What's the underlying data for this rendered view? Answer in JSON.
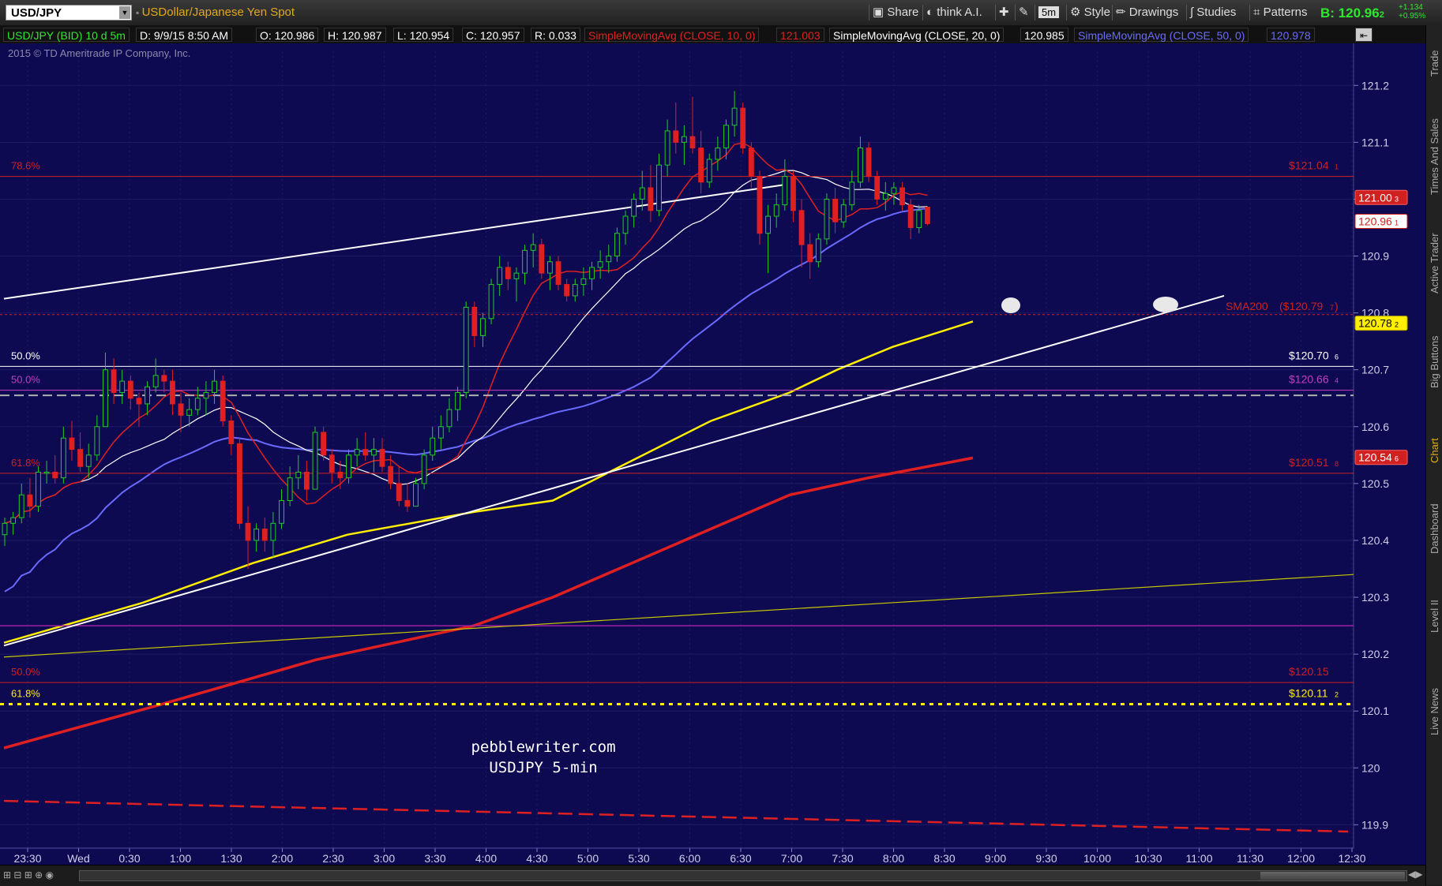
{
  "header": {
    "symbol": "USD/JPY",
    "description": "USDollar/Japanese Yen Spot",
    "toolbar": {
      "share": "Share",
      "think": "think A.I.",
      "interval": "5m",
      "style": "Style",
      "drawings": "Drawings",
      "studies": "Studies",
      "patterns": "Patterns"
    },
    "bid_label": "B:",
    "bid_value": "120.96",
    "bid_small": "2",
    "change1": "+1.134",
    "change2": "+0.95%"
  },
  "infobar": {
    "symbol_info": "USD/JPY (BID) 10 d 5m",
    "date": "D: 9/9/15 8:50 AM",
    "open": "O: 120.986",
    "high": "H: 120.987",
    "low": "L: 120.954",
    "close": "C: 120.957",
    "range": "R: 0.033",
    "sma10": "SimpleMovingAvg (CLOSE, 10, 0)",
    "sma10_value": "121.003",
    "sma20": "SimpleMovingAvg (CLOSE, 20, 0)",
    "sma20_value": "120.985",
    "sma50": "SimpleMovingAvg (CLOSE, 50, 0)",
    "sma50_value": "120.978"
  },
  "copyright": "2015 © TD Ameritrade IP Company, Inc.",
  "watermark": [
    "pebblewriter.com",
    "USDJPY 5-min"
  ],
  "right_tabs": [
    "Trade",
    "Times And Sales",
    "Active Trader",
    "Big Buttons",
    "Chart",
    "Dashboard",
    "Level II",
    "Live News"
  ],
  "chart_data": {
    "type": "candlestick",
    "title": "USD/JPY (BID) 10 d 5m",
    "x_tick_labels": [
      "23:30",
      "Wed",
      "0:30",
      "1:00",
      "1:30",
      "2:00",
      "2:30",
      "3:00",
      "3:30",
      "4:00",
      "4:30",
      "5:00",
      "5:30",
      "6:00",
      "6:30",
      "7:00",
      "7:30",
      "8:00",
      "8:30",
      "9:00",
      "9:30",
      "10:00",
      "10:30",
      "11:00",
      "11:30",
      "12:00",
      "12:30"
    ],
    "y_tick_labels": [
      "121.2",
      "121.1",
      "121",
      "120.9",
      "120.8",
      "120.7",
      "120.6",
      "120.5",
      "120.4",
      "120.3",
      "120.2",
      "120.1",
      "120",
      "119.9"
    ],
    "ylim": [
      119.87,
      121.26
    ],
    "candles": [
      [
        120.41,
        120.44,
        120.39,
        120.43
      ],
      [
        120.43,
        120.45,
        120.41,
        120.44
      ],
      [
        120.44,
        120.5,
        120.43,
        120.48
      ],
      [
        120.48,
        120.51,
        120.44,
        120.46
      ],
      [
        120.46,
        120.53,
        120.45,
        120.52
      ],
      [
        120.52,
        120.54,
        120.5,
        120.52
      ],
      [
        120.52,
        120.55,
        120.5,
        120.51
      ],
      [
        120.51,
        120.6,
        120.5,
        120.58
      ],
      [
        120.58,
        120.61,
        120.54,
        120.56
      ],
      [
        120.56,
        120.59,
        120.52,
        120.53
      ],
      [
        120.53,
        120.57,
        120.51,
        120.55
      ],
      [
        120.55,
        120.62,
        120.54,
        120.6
      ],
      [
        120.6,
        120.73,
        120.6,
        120.7
      ],
      [
        120.7,
        120.72,
        120.64,
        120.66
      ],
      [
        120.66,
        120.7,
        120.64,
        120.68
      ],
      [
        120.68,
        120.69,
        120.63,
        120.65
      ],
      [
        120.65,
        120.66,
        120.6,
        120.64
      ],
      [
        120.64,
        120.68,
        120.62,
        120.67
      ],
      [
        120.67,
        120.72,
        120.66,
        120.69
      ],
      [
        120.69,
        120.7,
        120.66,
        120.68
      ],
      [
        120.68,
        120.7,
        120.62,
        120.64
      ],
      [
        120.64,
        120.66,
        120.59,
        120.62
      ],
      [
        120.62,
        120.65,
        120.6,
        120.63
      ],
      [
        120.63,
        120.67,
        120.62,
        120.65
      ],
      [
        120.65,
        120.68,
        120.62,
        120.66
      ],
      [
        120.66,
        120.7,
        120.64,
        120.68
      ],
      [
        120.68,
        120.69,
        120.6,
        120.61
      ],
      [
        120.61,
        120.62,
        120.55,
        120.57
      ],
      [
        120.57,
        120.58,
        120.42,
        120.43
      ],
      [
        120.43,
        120.46,
        120.35,
        120.4
      ],
      [
        120.4,
        120.43,
        120.38,
        120.42
      ],
      [
        120.42,
        120.44,
        120.38,
        120.4
      ],
      [
        120.4,
        120.45,
        120.37,
        120.43
      ],
      [
        120.43,
        120.49,
        120.42,
        120.47
      ],
      [
        120.47,
        120.53,
        120.46,
        120.51
      ],
      [
        120.51,
        120.55,
        120.49,
        120.52
      ],
      [
        120.52,
        120.54,
        120.47,
        120.49
      ],
      [
        120.49,
        120.6,
        120.49,
        120.59
      ],
      [
        120.59,
        120.6,
        120.54,
        120.55
      ],
      [
        120.55,
        120.56,
        120.5,
        120.52
      ],
      [
        120.52,
        120.54,
        120.49,
        120.51
      ],
      [
        120.51,
        120.56,
        120.5,
        120.55
      ],
      [
        120.55,
        120.58,
        120.53,
        120.56
      ],
      [
        120.56,
        120.59,
        120.54,
        120.55
      ],
      [
        120.55,
        120.58,
        120.52,
        120.56
      ],
      [
        120.56,
        120.58,
        120.52,
        120.53
      ],
      [
        120.53,
        120.55,
        120.49,
        120.5
      ],
      [
        120.5,
        120.53,
        120.46,
        120.47
      ],
      [
        120.47,
        120.5,
        120.45,
        120.46
      ],
      [
        120.46,
        120.51,
        120.46,
        120.5
      ],
      [
        120.5,
        120.56,
        120.49,
        120.55
      ],
      [
        120.55,
        120.6,
        120.54,
        120.58
      ],
      [
        120.58,
        120.62,
        120.56,
        120.6
      ],
      [
        120.6,
        120.65,
        120.59,
        120.63
      ],
      [
        120.63,
        120.67,
        120.61,
        120.66
      ],
      [
        120.66,
        120.82,
        120.65,
        120.81
      ],
      [
        120.81,
        120.82,
        120.74,
        120.76
      ],
      [
        120.76,
        120.8,
        120.74,
        120.79
      ],
      [
        120.79,
        120.86,
        120.78,
        120.85
      ],
      [
        120.85,
        120.9,
        120.83,
        120.88
      ],
      [
        120.88,
        120.89,
        120.84,
        120.86
      ],
      [
        120.86,
        120.88,
        120.82,
        120.87
      ],
      [
        120.87,
        120.92,
        120.85,
        120.91
      ],
      [
        120.91,
        120.94,
        120.88,
        120.92
      ],
      [
        120.92,
        120.93,
        120.86,
        120.87
      ],
      [
        120.87,
        120.9,
        120.84,
        120.89
      ],
      [
        120.89,
        120.9,
        120.84,
        120.85
      ],
      [
        120.85,
        120.86,
        120.82,
        120.83
      ],
      [
        120.83,
        120.86,
        120.82,
        120.85
      ],
      [
        120.85,
        120.88,
        120.83,
        120.86
      ],
      [
        120.86,
        120.89,
        120.84,
        120.88
      ],
      [
        120.88,
        120.91,
        120.86,
        120.89
      ],
      [
        120.89,
        120.92,
        120.87,
        120.9
      ],
      [
        120.9,
        120.95,
        120.89,
        120.94
      ],
      [
        120.94,
        120.98,
        120.92,
        120.97
      ],
      [
        120.97,
        121.01,
        120.95,
        121.0
      ],
      [
        121.0,
        121.05,
        120.98,
        121.02
      ],
      [
        121.02,
        121.06,
        120.96,
        120.98
      ],
      [
        120.98,
        121.08,
        120.97,
        121.06
      ],
      [
        121.06,
        121.14,
        121.04,
        121.12
      ],
      [
        121.12,
        121.17,
        121.08,
        121.1
      ],
      [
        121.1,
        121.13,
        121.06,
        121.11
      ],
      [
        121.11,
        121.18,
        121.08,
        121.09
      ],
      [
        121.09,
        121.12,
        121.01,
        121.03
      ],
      [
        121.03,
        121.08,
        121.02,
        121.07
      ],
      [
        121.07,
        121.11,
        121.05,
        121.09
      ],
      [
        121.09,
        121.14,
        121.07,
        121.13
      ],
      [
        121.13,
        121.19,
        121.11,
        121.16
      ],
      [
        121.16,
        121.17,
        121.08,
        121.09
      ],
      [
        121.09,
        121.1,
        121.02,
        121.04
      ],
      [
        121.04,
        121.05,
        120.92,
        120.94
      ],
      [
        120.94,
        120.99,
        120.87,
        120.97
      ],
      [
        120.97,
        121.01,
        120.95,
        120.99
      ],
      [
        120.99,
        121.07,
        120.98,
        121.04
      ],
      [
        121.04,
        121.05,
        120.96,
        120.98
      ],
      [
        120.98,
        121.0,
        120.88,
        120.92
      ],
      [
        120.92,
        120.94,
        120.86,
        120.89
      ],
      [
        120.89,
        120.94,
        120.88,
        120.93
      ],
      [
        120.93,
        121.01,
        120.92,
        121.0
      ],
      [
        121.0,
        121.02,
        120.94,
        120.96
      ],
      [
        120.96,
        121.0,
        120.95,
        120.99
      ],
      [
        120.99,
        121.05,
        120.98,
        121.03
      ],
      [
        121.03,
        121.11,
        121.02,
        121.09
      ],
      [
        121.09,
        121.1,
        121.03,
        121.04
      ],
      [
        121.04,
        121.05,
        120.99,
        121.0
      ],
      [
        121.0,
        121.03,
        120.98,
        121.01
      ],
      [
        121.01,
        121.03,
        120.99,
        121.02
      ],
      [
        121.02,
        121.03,
        120.98,
        120.99
      ],
      [
        120.99,
        121.0,
        120.93,
        120.95
      ],
      [
        120.95,
        120.99,
        120.94,
        120.98
      ],
      [
        120.986,
        120.987,
        120.954,
        120.957
      ]
    ],
    "annotations": {
      "fib_lines": [
        {
          "pct": "78.6%",
          "price": 121.04,
          "label": "$121.04",
          "label_small": "1",
          "color": "#d02020"
        },
        {
          "pct": "50.0%",
          "price": 120.706,
          "label": "$120.70",
          "label_small": "6",
          "color": "#ffffff"
        },
        {
          "pct": "50.0%",
          "price": 120.664,
          "label": "$120.66",
          "label_small": "4",
          "color": "#c040c0"
        },
        {
          "pct": "61.8%",
          "price": 120.518,
          "label": "$120.51",
          "label_small": "8",
          "color": "#d02020"
        },
        {
          "pct": "50.0%",
          "price": 120.15,
          "label": "$120.15",
          "label_small": "",
          "color": "#d02020"
        },
        {
          "pct": "61.8%",
          "price": 120.112,
          "label": "$120.11",
          "label_small": "2",
          "color": "#ffee00"
        }
      ],
      "sma200_label": "SMA200",
      "sma200_text": "($120.79",
      "sma200_text_small": "7",
      "sma200_close": ")",
      "price_tags": [
        {
          "value": "121.00",
          "small": "3",
          "price": 121.003,
          "bg": "#d02020",
          "fg": "#ffffff",
          "border": "#ff6060"
        },
        {
          "value": "120.96",
          "small": "1",
          "price": 120.961,
          "bg": "#ffffff",
          "fg": "#d02020",
          "border": "#d02020"
        },
        {
          "value": "120.78",
          "small": "2",
          "price": 120.782,
          "bg": "#ffee00",
          "fg": "#000000",
          "border": "#b0a000"
        },
        {
          "value": "120.54",
          "small": "6",
          "price": 120.546,
          "bg": "#d02020",
          "fg": "#ffffff",
          "border": "#ff6060"
        }
      ]
    },
    "colors": {
      "background": "#0d0a52",
      "up_candle": "#22cc22",
      "down_candle": "#e02020",
      "sma10": "#e02020",
      "sma20": "#ffffff",
      "sma50": "#6a6aff",
      "sma100": "#ffee00",
      "sma200": "#e02020",
      "trendline": "#ffffff",
      "yellow_line": "#c8c800",
      "magenta_line": "#a020a0"
    }
  }
}
